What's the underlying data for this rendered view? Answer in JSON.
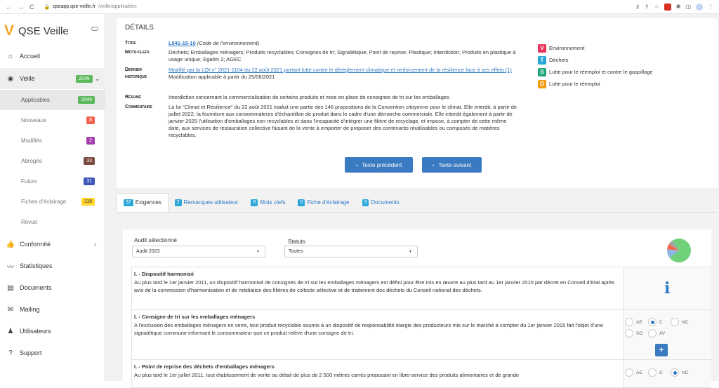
{
  "browser": {
    "url_host": "qseapp.qse-veille.fr",
    "url_path": "/veille/applicables"
  },
  "app": {
    "title": "QSE Veille"
  },
  "sidebar": {
    "items": [
      {
        "icon": "home-icon",
        "label": "Accueil"
      },
      {
        "icon": "eye-icon",
        "label": "Veille",
        "badge": "2049"
      },
      {
        "icon": "thumbs-up-icon",
        "label": "Conformité"
      },
      {
        "icon": "chart-line-icon",
        "label": "Statistiques"
      },
      {
        "icon": "document-icon",
        "label": "Documents"
      },
      {
        "icon": "mail-icon",
        "label": "Mailing"
      },
      {
        "icon": "users-icon",
        "label": "Utilisateurs"
      },
      {
        "icon": "help-icon",
        "label": "Support"
      }
    ],
    "sub": [
      {
        "label": "Applicables",
        "badge": "2049"
      },
      {
        "label": "Nouveaux",
        "badge": "8"
      },
      {
        "label": "Modifiés",
        "badge": "2"
      },
      {
        "label": "Abrogés",
        "badge": "33"
      },
      {
        "label": "Futurs",
        "badge": "31"
      },
      {
        "label": "Fiches d'éclairage",
        "badge": "118"
      },
      {
        "label": "Revue",
        "badge": ""
      }
    ]
  },
  "details": {
    "heading": "DÉTAILS",
    "titre_k": "Titre",
    "titre_link": "L541-15-10",
    "titre_code": "(Code de l'environnement)",
    "mots_k": "Mots-clefs",
    "mots_v": "Déchets; Emballages ménagers; Produits recyclables; Consignes de tri; Signalétique; Point de reprise; Plastique; Interdiction; Produits en plastique à usage unique; Egalim 2; AGEC",
    "hist_k1": "Dernier",
    "hist_k2": "historique",
    "hist_link": "Modifié par la LOI n° 2021-1104 du 22 août 2021 portant lutte contre le dérèglement climatique et renforcement de la résilience face à ses effets (1)",
    "hist_note": "Modification applicable à partir du 25/08/2021",
    "resume_k": "Résumé",
    "resume_v": "Interdiction concernant la commercialisation de certains produits et mise en place de consignes de tri sur les emballages",
    "comm_k": "Commentaire",
    "comm_v": "La loi \"Climat et Résilience\" du 22 août 2021 traduit une partie des 146 propositions de la Convention citoyenne pour le climat. Elle interdit, à partir de juillet 2022, la fourniture aux consommateurs d'échantillon de produit dans le cadre d'une démarche commerciale. Elle interdit également à partir de janvier 2025 l'utilisation d'emballages non recyclables et dans l'incapacité d'intégrer une filière de recyclage, et impose, à compter de cette même date, aux services de restauration collective faisant de la vente à emporter de proposer des contenants réutilisables ou composés de matières recyclables.",
    "prev": "Texte précédent",
    "next": "Texte suivant",
    "themes": [
      {
        "letter": "V",
        "label": "Environnement",
        "color": "#e8325a"
      },
      {
        "letter": "T",
        "label": "Déchets",
        "color": "#2aa6d9"
      },
      {
        "letter": "S",
        "label": "Lutte pour le réemploi et contre le gaspillage",
        "color": "#21a67a"
      },
      {
        "letter": "D",
        "label": "Lutte pour le réemploi",
        "color": "#f39c12"
      }
    ]
  },
  "tabs": [
    {
      "count": "37",
      "label": "Exigences"
    },
    {
      "count": "2",
      "label": "Remarques utilisateur"
    },
    {
      "count": "8",
      "label": "Mots clefs"
    },
    {
      "count": "0",
      "label": "Fiche d'éclairage"
    },
    {
      "count": "3",
      "label": "Documents"
    }
  ],
  "filters": {
    "audit_label": "Audit sélectionné",
    "audit_value": "Audit 2023",
    "statut_label": "Statuts",
    "statut_value": "Toutes"
  },
  "pie": [
    {
      "value": 74,
      "color": "#6fd17a"
    },
    {
      "value": 12,
      "color": "#8fb6e3"
    },
    {
      "value": 8,
      "color": "#f06a50"
    },
    {
      "value": 6,
      "color": "#a3a3a3"
    }
  ],
  "requirements": [
    {
      "title": "I. - Dispositif harmonisé",
      "text": "Au plus tard le 1er janvier 2011, un dispositif harmonisé de consignes de tri sur les emballages ménagers est défini pour être mis en œuvre au plus tard au 1er janvier 2015 par décret en Conseil d'Etat après avis de la commission d'harmonisation et de médiation des filières de collecte sélective et de traitement des déchets du Conseil national des déchets."
    },
    {
      "title": "I. - Consigne de tri sur les emballages ménagers",
      "text": "A l'exclusion des emballages ménagers en verre, tout produit recyclable soumis à un dispositif de responsabilité élargie des producteurs mis sur le marché à compter du 1er janvier 2015 fait l'objet d'une signalétique commune informant le consommateur que ce produit relève d'une consigne de tri."
    },
    {
      "title": "I. - Point de reprise des déchets d'emballages ménagers",
      "text": "Au plus tard le 1er juillet 2011, tout établissement de vente au détail de plus de 2 500 mètres carrés proposant en libre-service des produits alimentaires et de grande"
    }
  ],
  "status_opts": {
    "ae": "AE",
    "c": "C",
    "nc": "NC",
    "so": "SO",
    "av": "AV"
  }
}
